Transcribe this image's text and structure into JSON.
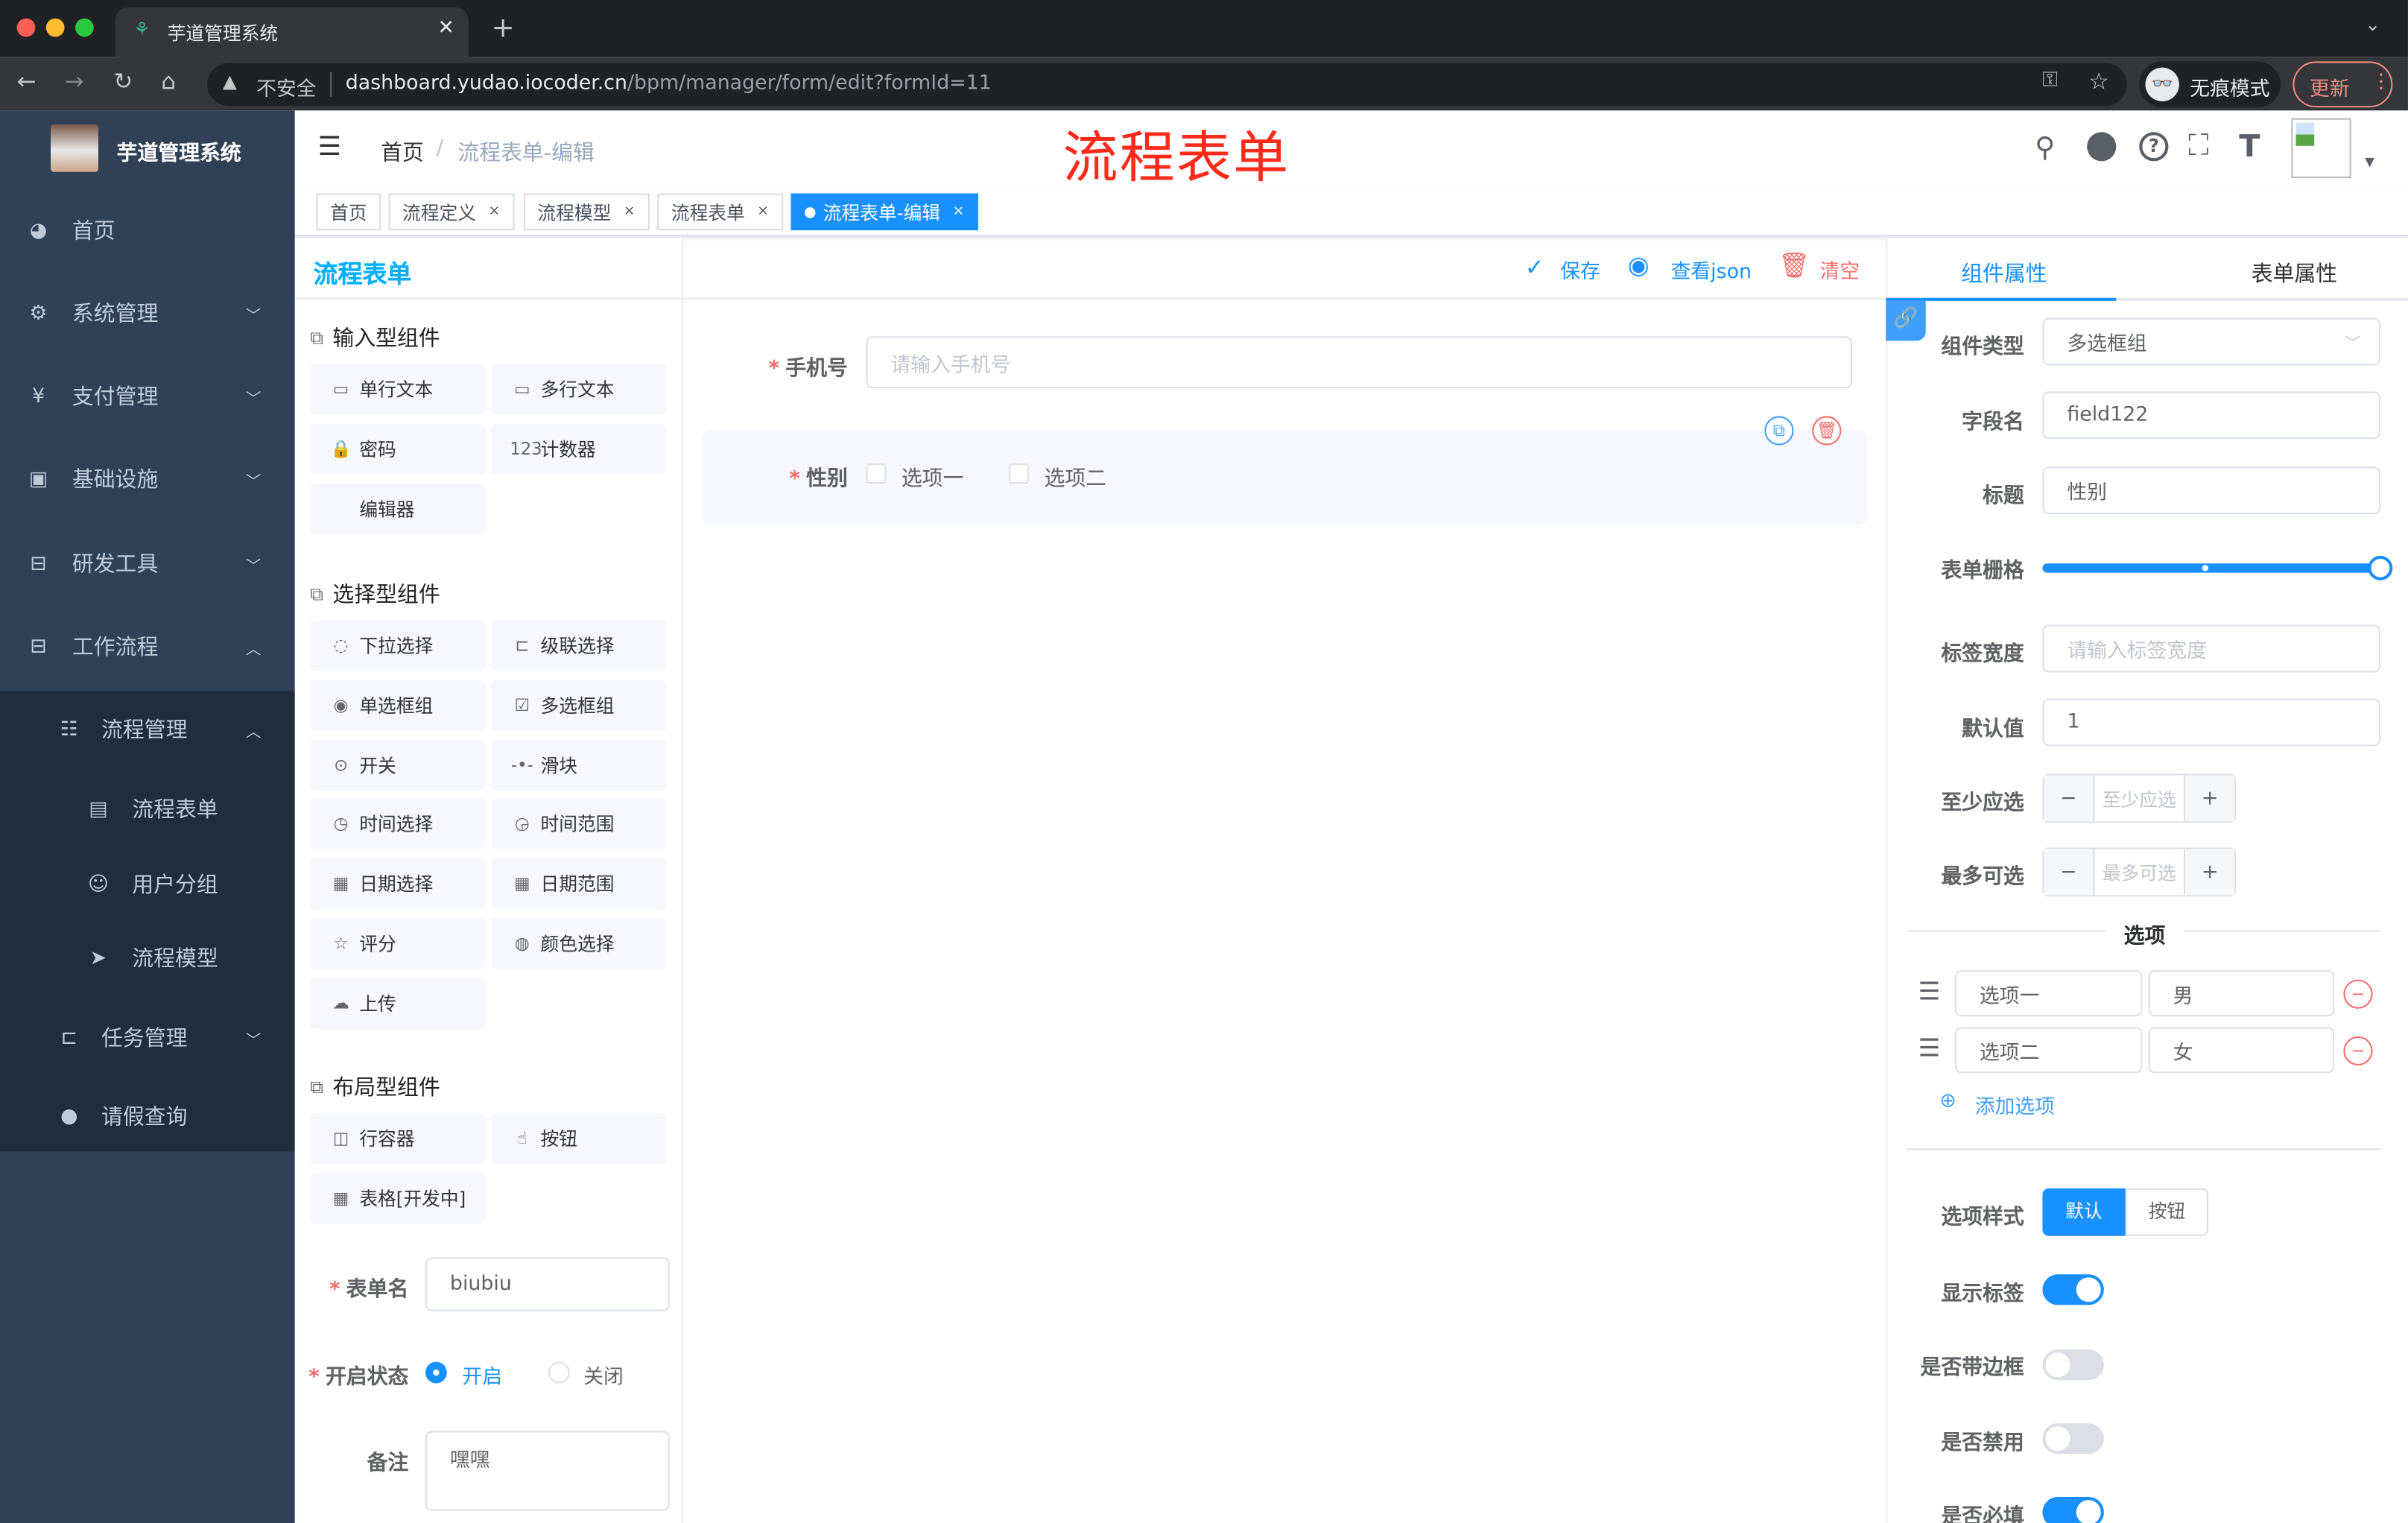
{
  "browser": {
    "tab_title": "芋道管理系统",
    "security_label": "不安全",
    "url_host": "dashboard.yudao.iocoder.cn",
    "url_path": "/bpm/manager/form/edit?formId=11",
    "incognito_label": "无痕模式",
    "update_label": "更新"
  },
  "sidebar": {
    "app_title": "芋道管理系统",
    "items": [
      {
        "label": "首页",
        "icon": "dashboard-icon",
        "level": 0,
        "chevron": ""
      },
      {
        "label": "系统管理",
        "icon": "gear-icon",
        "level": 0,
        "chevron": "down"
      },
      {
        "label": "支付管理",
        "icon": "yen-icon",
        "level": 0,
        "chevron": "down"
      },
      {
        "label": "基础设施",
        "icon": "monitor-icon",
        "level": 0,
        "chevron": "down"
      },
      {
        "label": "研发工具",
        "icon": "toolbox-icon",
        "level": 0,
        "chevron": "down"
      },
      {
        "label": "工作流程",
        "icon": "toolbox-icon",
        "level": 0,
        "chevron": "up"
      },
      {
        "label": "流程管理",
        "icon": "tree-list-icon",
        "level": 1,
        "chevron": "up"
      },
      {
        "label": "流程表单",
        "icon": "form-icon",
        "level": 2,
        "chevron": ""
      },
      {
        "label": "用户分组",
        "icon": "user-group-icon",
        "level": 2,
        "chevron": ""
      },
      {
        "label": "流程模型",
        "icon": "send-icon",
        "level": 2,
        "chevron": ""
      },
      {
        "label": "任务管理",
        "icon": "tree-icon",
        "level": 1,
        "chevron": "down"
      },
      {
        "label": "请假查询",
        "icon": "user-icon",
        "level": 1,
        "chevron": ""
      }
    ]
  },
  "navbar": {
    "breadcrumb_home": "首页",
    "breadcrumb_current": "流程表单-编辑",
    "overlay_title": "流程表单"
  },
  "tags": [
    {
      "label": "首页",
      "closable": false,
      "active": false
    },
    {
      "label": "流程定义",
      "closable": true,
      "active": false
    },
    {
      "label": "流程模型",
      "closable": true,
      "active": false
    },
    {
      "label": "流程表单",
      "closable": true,
      "active": false
    },
    {
      "label": "流程表单-编辑",
      "closable": true,
      "active": true
    }
  ],
  "palette": {
    "header": "流程表单",
    "groups": [
      {
        "title": "输入型组件",
        "items": [
          {
            "label": "单行文本",
            "icon": "input-icon"
          },
          {
            "label": "多行文本",
            "icon": "textarea-icon"
          },
          {
            "label": "密码",
            "icon": "lock-icon"
          },
          {
            "label": "计数器",
            "icon": "number-icon"
          },
          {
            "label": "编辑器",
            "icon": ""
          }
        ]
      },
      {
        "title": "选择型组件",
        "items": [
          {
            "label": "下拉选择",
            "icon": "select-icon"
          },
          {
            "label": "级联选择",
            "icon": "cascader-icon"
          },
          {
            "label": "单选框组",
            "icon": "radio-icon"
          },
          {
            "label": "多选框组",
            "icon": "checkbox-icon"
          },
          {
            "label": "开关",
            "icon": "switch-icon"
          },
          {
            "label": "滑块",
            "icon": "slider-icon"
          },
          {
            "label": "时间选择",
            "icon": "clock-icon"
          },
          {
            "label": "时间范围",
            "icon": "time-range-icon"
          },
          {
            "label": "日期选择",
            "icon": "calendar-icon"
          },
          {
            "label": "日期范围",
            "icon": "date-range-icon"
          },
          {
            "label": "评分",
            "icon": "star-icon"
          },
          {
            "label": "颜色选择",
            "icon": "palette-icon"
          },
          {
            "label": "上传",
            "icon": "upload-icon"
          }
        ]
      },
      {
        "title": "布局型组件",
        "items": [
          {
            "label": "行容器",
            "icon": "row-icon"
          },
          {
            "label": "按钮",
            "icon": "pointer-icon"
          },
          {
            "label": "表格[开发中]",
            "icon": "table-icon"
          }
        ]
      }
    ],
    "form_name_label": "表单名",
    "form_name_value": "biubiu",
    "status_label": "开启状态",
    "status_on": "开启",
    "status_off": "关闭",
    "status_selected": "开启",
    "remark_label": "备注",
    "remark_value": "嘿嘿"
  },
  "canvas": {
    "save_label": "保存",
    "json_label": "查看json",
    "clear_label": "清空",
    "phone_label": "手机号",
    "phone_placeholder": "请输入手机号",
    "gender_label": "性别",
    "options": [
      "选项一",
      "选项二"
    ]
  },
  "props": {
    "tab_component": "组件属性",
    "tab_form": "表单属性",
    "type_label": "组件类型",
    "type_value": "多选框组",
    "field_label": "字段名",
    "field_value": "field122",
    "title_label": "标题",
    "title_value": "性别",
    "grid_label": "表单栅格",
    "grid_fraction": 1.0,
    "label_width_label": "标签宽度",
    "label_width_placeholder": "请输入标签宽度",
    "default_label": "默认值",
    "default_value": "1",
    "min_label": "至少应选",
    "min_placeholder": "至少应选",
    "max_label": "最多可选",
    "max_placeholder": "最多可选",
    "options_divider": "选项",
    "options": [
      {
        "label": "选项一",
        "value": "男"
      },
      {
        "label": "选项二",
        "value": "女"
      }
    ],
    "add_option": "添加选项",
    "style_label": "选项样式",
    "style_default": "默认",
    "style_button": "按钮",
    "style_selected": "默认",
    "show_label_label": "显示标签",
    "show_label": true,
    "border_label": "是否带边框",
    "border": false,
    "disabled_label": "是否禁用",
    "disabled": false,
    "required_label": "是否必填",
    "required": true
  },
  "colors": {
    "primary": "#1890ff",
    "sidebar": "#304156",
    "danger": "#f56c6c",
    "overlay_title": "#ff2a1a"
  }
}
